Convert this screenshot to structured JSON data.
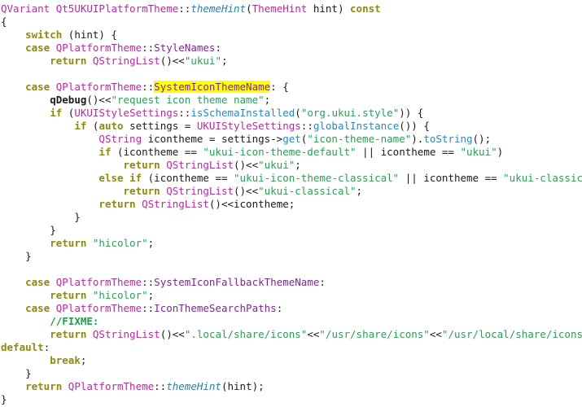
{
  "document": {
    "kind": "source-code-view",
    "language": "C++",
    "background_color": "#ffffff",
    "highlight_color": "#ffff00",
    "colors": {
      "plain": "#1a1a1a",
      "type": "#b02f9c",
      "enum_member": "#7a2a8a",
      "keyword": "#8a8a14",
      "function_italic": "#2a7fa8",
      "method": "#2f86b8",
      "string": "#2e9b57",
      "comment": "#1f9b4e"
    }
  },
  "code": {
    "lines": [
      {
        "id": "line-1",
        "tokens": [
          {
            "c": "t-type",
            "s": "QVariant"
          },
          {
            "c": "t-plain",
            "s": " "
          },
          {
            "c": "t-type",
            "s": "Qt5UKUIPlatformTheme"
          },
          {
            "c": "t-plain",
            "s": "::"
          },
          {
            "c": "t-func",
            "s": "themeHint"
          },
          {
            "c": "t-plain",
            "s": "("
          },
          {
            "c": "t-type",
            "s": "ThemeHint"
          },
          {
            "c": "t-plain",
            "s": " hint) "
          },
          {
            "c": "t-keyword",
            "s": "const"
          }
        ]
      },
      {
        "id": "line-2",
        "tokens": [
          {
            "c": "t-plain",
            "s": "{"
          }
        ]
      },
      {
        "id": "line-3",
        "tokens": [
          {
            "c": "t-plain",
            "s": "    "
          },
          {
            "c": "t-keyword",
            "s": "switch"
          },
          {
            "c": "t-plain",
            "s": " (hint) {"
          }
        ]
      },
      {
        "id": "line-4",
        "tokens": [
          {
            "c": "t-plain",
            "s": "    "
          },
          {
            "c": "t-keyword",
            "s": "case"
          },
          {
            "c": "t-plain",
            "s": " "
          },
          {
            "c": "t-type",
            "s": "QPlatformTheme"
          },
          {
            "c": "t-plain",
            "s": "::"
          },
          {
            "c": "t-type2",
            "s": "StyleNames"
          },
          {
            "c": "t-plain",
            "s": ":"
          }
        ]
      },
      {
        "id": "line-5",
        "tokens": [
          {
            "c": "t-plain",
            "s": "        "
          },
          {
            "c": "t-keyword",
            "s": "return"
          },
          {
            "c": "t-plain",
            "s": " "
          },
          {
            "c": "t-type",
            "s": "QStringList"
          },
          {
            "c": "t-plain",
            "s": "()<<"
          },
          {
            "c": "t-string",
            "s": "\"ukui\""
          },
          {
            "c": "t-plain",
            "s": ";"
          }
        ]
      },
      {
        "id": "line-6",
        "tokens": []
      },
      {
        "id": "line-7",
        "tokens": [
          {
            "c": "t-plain",
            "s": "    "
          },
          {
            "c": "t-keyword",
            "s": "case"
          },
          {
            "c": "t-plain",
            "s": " "
          },
          {
            "c": "t-type",
            "s": "QPlatformTheme"
          },
          {
            "c": "t-plain",
            "s": "::"
          },
          {
            "c": "t-hl",
            "s": "SystemIconThemeName"
          },
          {
            "c": "t-plain",
            "s": ": {"
          }
        ]
      },
      {
        "id": "line-8",
        "tokens": [
          {
            "c": "t-plain",
            "s": "        "
          },
          {
            "c": "t-bold",
            "s": "qDebug"
          },
          {
            "c": "t-plain",
            "s": "()<<"
          },
          {
            "c": "t-string",
            "s": "\"request icon theme name\""
          },
          {
            "c": "t-plain",
            "s": ";"
          }
        ]
      },
      {
        "id": "line-9",
        "tokens": [
          {
            "c": "t-plain",
            "s": "        "
          },
          {
            "c": "t-keyword",
            "s": "if"
          },
          {
            "c": "t-plain",
            "s": " ("
          },
          {
            "c": "t-type",
            "s": "UKUIStyleSettings"
          },
          {
            "c": "t-plain",
            "s": "::"
          },
          {
            "c": "t-method",
            "s": "isSchemaInstalled"
          },
          {
            "c": "t-plain",
            "s": "("
          },
          {
            "c": "t-string",
            "s": "\"org.ukui.style\""
          },
          {
            "c": "t-plain",
            "s": ")) {"
          }
        ]
      },
      {
        "id": "line-10",
        "tokens": [
          {
            "c": "t-plain",
            "s": "            "
          },
          {
            "c": "t-keyword",
            "s": "if"
          },
          {
            "c": "t-plain",
            "s": " ("
          },
          {
            "c": "t-keyword",
            "s": "auto"
          },
          {
            "c": "t-plain",
            "s": " settings = "
          },
          {
            "c": "t-type",
            "s": "UKUIStyleSettings"
          },
          {
            "c": "t-plain",
            "s": "::"
          },
          {
            "c": "t-method",
            "s": "globalInstance"
          },
          {
            "c": "t-plain",
            "s": "()) {"
          }
        ]
      },
      {
        "id": "line-11",
        "tokens": [
          {
            "c": "t-plain",
            "s": "                "
          },
          {
            "c": "t-type",
            "s": "QString"
          },
          {
            "c": "t-plain",
            "s": " icontheme = settings->"
          },
          {
            "c": "t-method",
            "s": "get"
          },
          {
            "c": "t-plain",
            "s": "("
          },
          {
            "c": "t-string",
            "s": "\"icon-theme-name\""
          },
          {
            "c": "t-plain",
            "s": ")."
          },
          {
            "c": "t-method",
            "s": "toString"
          },
          {
            "c": "t-plain",
            "s": "();"
          }
        ]
      },
      {
        "id": "line-12",
        "tokens": [
          {
            "c": "t-plain",
            "s": "                "
          },
          {
            "c": "t-keyword",
            "s": "if"
          },
          {
            "c": "t-plain",
            "s": " (icontheme == "
          },
          {
            "c": "t-string",
            "s": "\"ukui-icon-theme-default\""
          },
          {
            "c": "t-plain",
            "s": " || icontheme == "
          },
          {
            "c": "t-string",
            "s": "\"ukui\""
          },
          {
            "c": "t-plain",
            "s": ")"
          }
        ]
      },
      {
        "id": "line-13",
        "tokens": [
          {
            "c": "t-plain",
            "s": "                    "
          },
          {
            "c": "t-keyword",
            "s": "return"
          },
          {
            "c": "t-plain",
            "s": " "
          },
          {
            "c": "t-type",
            "s": "QStringList"
          },
          {
            "c": "t-plain",
            "s": "()<<"
          },
          {
            "c": "t-string",
            "s": "\"ukui\""
          },
          {
            "c": "t-plain",
            "s": ";"
          }
        ]
      },
      {
        "id": "line-14",
        "tokens": [
          {
            "c": "t-plain",
            "s": "                "
          },
          {
            "c": "t-keyword",
            "s": "else"
          },
          {
            "c": "t-plain",
            "s": " "
          },
          {
            "c": "t-keyword",
            "s": "if"
          },
          {
            "c": "t-plain",
            "s": " (icontheme == "
          },
          {
            "c": "t-string",
            "s": "\"ukui-icon-theme-classical\""
          },
          {
            "c": "t-plain",
            "s": " || icontheme == "
          },
          {
            "c": "t-string",
            "s": "\"ukui-classical\""
          },
          {
            "c": "t-plain",
            "s": ")"
          }
        ]
      },
      {
        "id": "line-15",
        "tokens": [
          {
            "c": "t-plain",
            "s": "                    "
          },
          {
            "c": "t-keyword",
            "s": "return"
          },
          {
            "c": "t-plain",
            "s": " "
          },
          {
            "c": "t-type",
            "s": "QStringList"
          },
          {
            "c": "t-plain",
            "s": "()<<"
          },
          {
            "c": "t-string",
            "s": "\"ukui-classical\""
          },
          {
            "c": "t-plain",
            "s": ";"
          }
        ]
      },
      {
        "id": "line-16",
        "tokens": [
          {
            "c": "t-plain",
            "s": "                "
          },
          {
            "c": "t-keyword",
            "s": "return"
          },
          {
            "c": "t-plain",
            "s": " "
          },
          {
            "c": "t-type",
            "s": "QStringList"
          },
          {
            "c": "t-plain",
            "s": "()<<icontheme;"
          }
        ]
      },
      {
        "id": "line-17",
        "tokens": [
          {
            "c": "t-plain",
            "s": "            }"
          }
        ]
      },
      {
        "id": "line-18",
        "tokens": [
          {
            "c": "t-plain",
            "s": "        }"
          }
        ]
      },
      {
        "id": "line-19",
        "tokens": [
          {
            "c": "t-plain",
            "s": "        "
          },
          {
            "c": "t-keyword",
            "s": "return"
          },
          {
            "c": "t-plain",
            "s": " "
          },
          {
            "c": "t-string",
            "s": "\"hicolor\""
          },
          {
            "c": "t-plain",
            "s": ";"
          }
        ]
      },
      {
        "id": "line-20",
        "tokens": [
          {
            "c": "t-plain",
            "s": "    }"
          }
        ]
      },
      {
        "id": "line-21",
        "tokens": []
      },
      {
        "id": "line-22",
        "tokens": [
          {
            "c": "t-plain",
            "s": "    "
          },
          {
            "c": "t-keyword",
            "s": "case"
          },
          {
            "c": "t-plain",
            "s": " "
          },
          {
            "c": "t-type",
            "s": "QPlatformTheme"
          },
          {
            "c": "t-plain",
            "s": "::"
          },
          {
            "c": "t-type2",
            "s": "SystemIconFallbackThemeName"
          },
          {
            "c": "t-plain",
            "s": ":"
          }
        ]
      },
      {
        "id": "line-23",
        "tokens": [
          {
            "c": "t-plain",
            "s": "        "
          },
          {
            "c": "t-keyword",
            "s": "return"
          },
          {
            "c": "t-plain",
            "s": " "
          },
          {
            "c": "t-string",
            "s": "\"hicolor\""
          },
          {
            "c": "t-plain",
            "s": ";"
          }
        ]
      },
      {
        "id": "line-24",
        "tokens": [
          {
            "c": "t-plain",
            "s": "    "
          },
          {
            "c": "t-keyword",
            "s": "case"
          },
          {
            "c": "t-plain",
            "s": " "
          },
          {
            "c": "t-type",
            "s": "QPlatformTheme"
          },
          {
            "c": "t-plain",
            "s": "::"
          },
          {
            "c": "t-type2",
            "s": "IconThemeSearchPaths"
          },
          {
            "c": "t-plain",
            "s": ":"
          }
        ]
      },
      {
        "id": "line-25",
        "tokens": [
          {
            "c": "t-plain",
            "s": "        "
          },
          {
            "c": "t-comment",
            "s": "//FIXME:"
          }
        ]
      },
      {
        "id": "line-26",
        "tokens": [
          {
            "c": "t-plain",
            "s": "        "
          },
          {
            "c": "t-keyword",
            "s": "return"
          },
          {
            "c": "t-plain",
            "s": " "
          },
          {
            "c": "t-type",
            "s": "QStringList"
          },
          {
            "c": "t-plain",
            "s": "()<<"
          },
          {
            "c": "t-string",
            "s": "\".local/share/icons\""
          },
          {
            "c": "t-plain",
            "s": "<<"
          },
          {
            "c": "t-string",
            "s": "\"/usr/share/icons\""
          },
          {
            "c": "t-plain",
            "s": "<<"
          },
          {
            "c": "t-string",
            "s": "\"/usr/local/share/icons\""
          },
          {
            "c": "t-plain",
            "s": ";"
          }
        ]
      },
      {
        "id": "line-27",
        "tokens": [
          {
            "c": "t-keyword",
            "s": "default"
          },
          {
            "c": "t-plain",
            "s": ":"
          }
        ]
      },
      {
        "id": "line-28",
        "tokens": [
          {
            "c": "t-plain",
            "s": "        "
          },
          {
            "c": "t-keyword",
            "s": "break"
          },
          {
            "c": "t-plain",
            "s": ";"
          }
        ]
      },
      {
        "id": "line-29",
        "tokens": [
          {
            "c": "t-plain",
            "s": "    }"
          }
        ]
      },
      {
        "id": "line-30",
        "tokens": [
          {
            "c": "t-plain",
            "s": "    "
          },
          {
            "c": "t-keyword",
            "s": "return"
          },
          {
            "c": "t-plain",
            "s": " "
          },
          {
            "c": "t-type",
            "s": "QPlatformTheme"
          },
          {
            "c": "t-plain",
            "s": "::"
          },
          {
            "c": "t-func",
            "s": "themeHint"
          },
          {
            "c": "t-plain",
            "s": "(hint);"
          }
        ]
      },
      {
        "id": "line-31",
        "tokens": [
          {
            "c": "t-plain",
            "s": "}"
          }
        ]
      }
    ]
  }
}
